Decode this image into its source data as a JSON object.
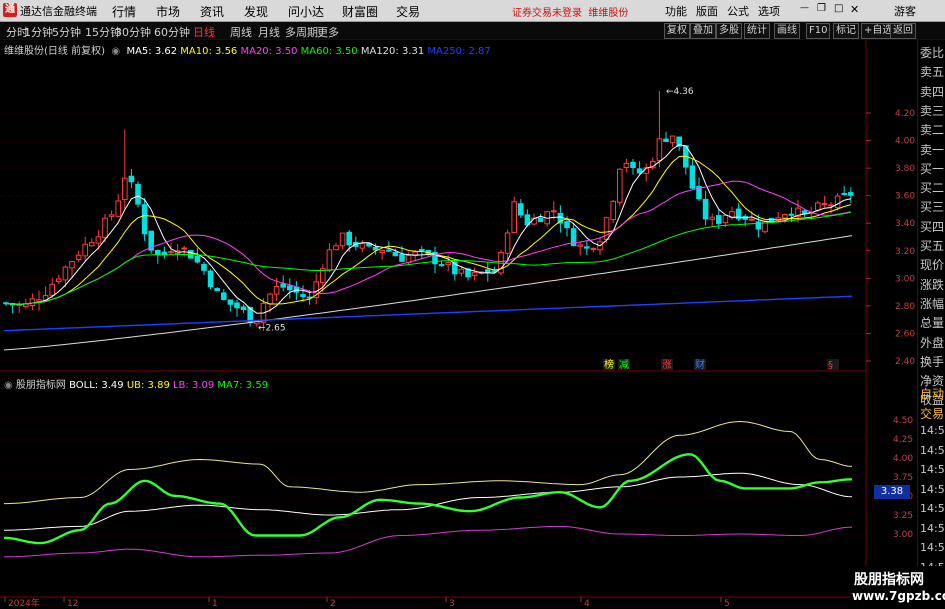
{
  "app": {
    "title": "通达信金融终端",
    "logo": "通"
  },
  "menu": [
    "行情",
    "市场",
    "资讯",
    "发现",
    "问小达",
    "财富圈",
    "交易"
  ],
  "notice": {
    "text": "证券交易未登录",
    "stock": "维维股份"
  },
  "top_right": [
    "功能",
    "版面",
    "公式",
    "选项",
    "游客"
  ],
  "periods": [
    "分时",
    "1分钟",
    "5分钟",
    "15分钟",
    "30分钟",
    "60分钟",
    "日线",
    "周线",
    "月线",
    "多周期",
    "更多"
  ],
  "active_period": "日线",
  "toolbar_buttons": [
    "复权",
    "叠加",
    "多股",
    "统计",
    "画线",
    "F10",
    "标记",
    "+自选",
    "返回"
  ],
  "main_header": {
    "stock": "维维股份(日线 前复权)",
    "ma": [
      {
        "label": "MA5: 3.62",
        "color": "#ffffff"
      },
      {
        "label": "MA10: 3.56",
        "color": "#ffff00"
      },
      {
        "label": "MA20: 3.50",
        "color": "#ff40ff"
      },
      {
        "label": "MA60: 3.50",
        "color": "#00ff00"
      },
      {
        "label": "MA120: 3.31",
        "color": "#e0e0e0"
      },
      {
        "label": "MA250: 2.87",
        "color": "#2040ff"
      }
    ]
  },
  "main_axis": [
    "4.20",
    "4.00",
    "3.80",
    "3.60",
    "3.40",
    "3.20",
    "3.00",
    "2.80",
    "2.60",
    "2.40"
  ],
  "annotations": {
    "high": "4.36",
    "low": "2.65"
  },
  "event_markers": [
    {
      "text": "榜",
      "color": "#ffff00"
    },
    {
      "text": "减",
      "color": "#00ff00"
    },
    {
      "text": "涨",
      "color": "#ff3030"
    },
    {
      "text": "财",
      "color": "#3080ff"
    },
    {
      "text": "§",
      "color": "#ff3030"
    }
  ],
  "sub_header": {
    "name": "股朋指标网",
    "items": [
      {
        "label": "BOLL: 3.49",
        "color": "#ffffff"
      },
      {
        "label": "UB: 3.89",
        "color": "#ffff00"
      },
      {
        "label": "LB: 3.09",
        "color": "#ff40ff"
      },
      {
        "label": "MA7: 3.59",
        "color": "#00ff00"
      }
    ]
  },
  "sub_axis": [
    "4.50",
    "4.25",
    "4.00",
    "3.75",
    "3.50",
    "3.25",
    "3.00"
  ],
  "sub_price_box": "3.38",
  "right_panel": [
    "委比",
    "卖五",
    "卖四",
    "卖三",
    "卖二",
    "卖一",
    "买一",
    "买二",
    "买三",
    "买四",
    "买五",
    "现价",
    "涨跌",
    "涨幅",
    "总量",
    "外盘",
    "换手",
    "净资",
    "收益"
  ],
  "right_panel_bottom": [
    "自动",
    "交易",
    "14:56",
    "14:56",
    "14:56",
    "14:56",
    "14:56",
    "14:56",
    "14:56",
    "14:56"
  ],
  "date_axis": [
    "2024年",
    "12",
    "1",
    "2",
    "3",
    "4",
    "5"
  ],
  "watermark": {
    "line1": "股朋指标网",
    "line2": "www.7gpzb.com"
  }
}
